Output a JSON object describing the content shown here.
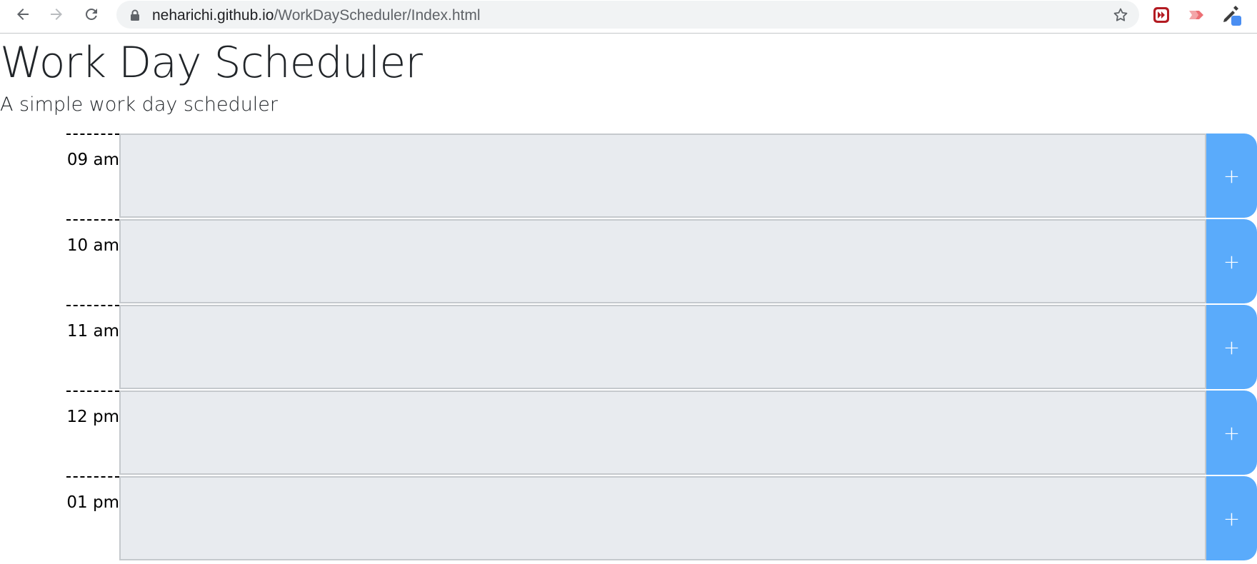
{
  "browser": {
    "url_host": "neharichi.github.io",
    "url_path": "/WorkDayScheduler/Index.html",
    "icons": [
      "back-arrow-icon",
      "forward-arrow-icon",
      "reload-icon",
      "lock-icon",
      "star-icon",
      "extension-red-icon",
      "extension-pink-icon",
      "eyedropper-icon"
    ]
  },
  "page": {
    "title": "Work Day Scheduler",
    "subtitle": "A simple work day scheduler"
  },
  "schedule": {
    "rows": [
      {
        "hour": "09 am",
        "event": "",
        "save_label": "+"
      },
      {
        "hour": "10 am",
        "event": "",
        "save_label": "+"
      },
      {
        "hour": "11 am",
        "event": "",
        "save_label": "+"
      },
      {
        "hour": "12 pm",
        "event": "",
        "save_label": "+"
      },
      {
        "hour": "01 pm",
        "event": "",
        "save_label": "+"
      }
    ]
  },
  "colors": {
    "save_button": "#5aabfb",
    "event_field": "#e8ebef",
    "title_text": "#212529"
  }
}
